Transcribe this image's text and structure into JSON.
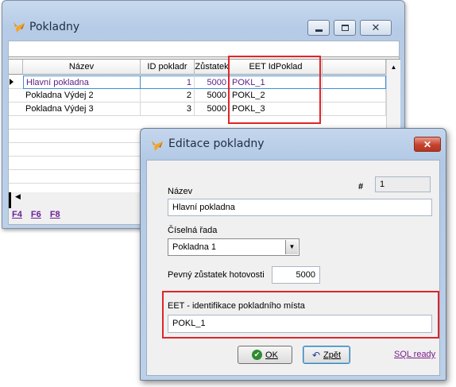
{
  "main_window": {
    "title": "Pokladny",
    "search_value": "",
    "columns": [
      "Název",
      "ID pokladr",
      "Zůstatek",
      "EET IdPoklad"
    ],
    "rows": [
      {
        "name": "Hlavní pokladna",
        "id": "1",
        "balance": "5000",
        "eet": "POKL_1"
      },
      {
        "name": "Pokladna Výdej  2",
        "id": "2",
        "balance": "5000",
        "eet": "POKL_2"
      },
      {
        "name": "Pokladna Výdej 3",
        "id": "3",
        "balance": "5000",
        "eet": "POKL_3"
      }
    ],
    "selected_row": 0,
    "function_keys": [
      "F4",
      "F6",
      "F8"
    ],
    "icons": {
      "app": "fox-icon",
      "minimize": "minimize-icon",
      "maximize": "maximize-icon",
      "close": "close-icon"
    }
  },
  "dialog": {
    "title": "Editace pokladny",
    "hash_label": "#",
    "id_value": "1",
    "name_label": "Název",
    "name_value": "Hlavní pokladna",
    "series_label": "Číselná řada",
    "series_value": "Pokladna 1",
    "balance_label": "Pevný zůstatek hotovosti",
    "balance_value": "5000",
    "eet_label": "EET - identifikace pokladního místa",
    "eet_value": "POKL_1",
    "ok_label": "OK",
    "back_label": "Zpět",
    "sql_label": "SQL ready",
    "close_glyph": "✕"
  },
  "colors": {
    "highlight_red": "#e0252a",
    "link_purple": "#7a1e8e",
    "selected_text": "#5a1e82"
  }
}
